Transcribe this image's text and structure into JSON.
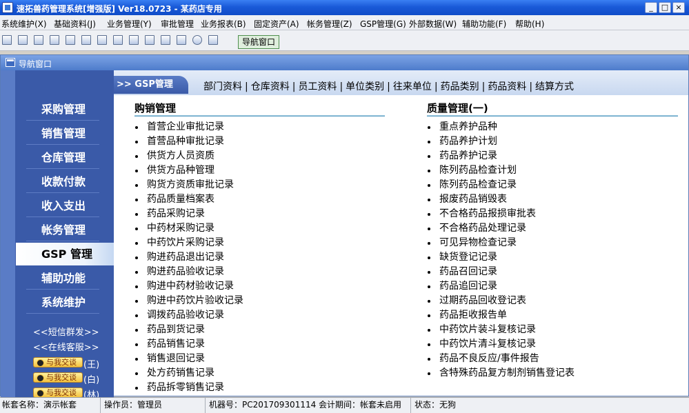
{
  "window": {
    "title": "速拓兽药管理系统[增强版] Ver18.0723 - 某药店专用",
    "min_glyph": "_",
    "max_glyph": "□",
    "close_glyph": "×"
  },
  "menu": [
    "系统维护(X)",
    "基础资料(J)",
    "业务管理(Y)",
    "审批管理",
    "业务报表(B)",
    "固定资产(A)",
    "帐务管理(Z)",
    "GSP管理(G)",
    "外部数据(W)",
    "辅助功能(F)",
    "帮助(H)"
  ],
  "toolbar": {
    "icons": [
      "grid-icon",
      "window-icon",
      "toolbox-icon",
      "card-icon",
      "chart-icon",
      "link-icon",
      "users-icon",
      "folder-icon",
      "edit-icon",
      "keyboard-icon",
      "save-icon",
      "print-icon",
      "help-icon",
      "exit-icon"
    ],
    "nav_button": "导航窗口"
  },
  "nav_window": {
    "title": "导航窗口"
  },
  "sidebar": {
    "items": [
      "采购管理",
      "销售管理",
      "仓库管理",
      "收款付款",
      "收入支出",
      "帐务管理",
      "GSP 管理",
      "辅助功能",
      "系统维护"
    ],
    "active_index": 6,
    "sms_link": "<<短信群发>>",
    "service_link": "<<在线客服>>",
    "qq": [
      {
        "label": "与我交谈",
        "who": "(王)"
      },
      {
        "label": "与我交谈",
        "who": "(白)"
      },
      {
        "label": "与我交谈",
        "who": "(林)"
      }
    ]
  },
  "content": {
    "section_tab": ">> GSP管理",
    "quick_links": [
      "部门资料",
      "仓库资料",
      "员工资料",
      "单位类别",
      "往来单位",
      "药品类别",
      "药品资料",
      "结算方式"
    ],
    "left_title": "购销管理",
    "left_items": [
      "首营企业审批记录",
      "首营品种审批记录",
      "供货方人员资质",
      "供货方品种管理",
      "购货方资质审批记录",
      "药品质量档案表",
      "药品采购记录",
      "中药材采购记录",
      "中药饮片采购记录",
      "购进药品退出记录",
      "购进药品验收记录",
      "购进中药材验收记录",
      "购进中药饮片验收记录",
      "调拨药品验收记录",
      "药品到货记录",
      "药品销售记录",
      "销售退回记录",
      "处方药销售记录",
      "药品拆零销售记录"
    ],
    "right_title": "质量管理(一)",
    "right_items": [
      "重点养护品种",
      "药品养护计划",
      "药品养护记录",
      "陈列药品检查计划",
      "陈列药品检查记录",
      "报废药品销毁表",
      "不合格药品报损审批表",
      "不合格药品处理记录",
      "可见异物检查记录",
      "缺货登记记录",
      "药品召回记录",
      "药品追回记录",
      "过期药品回收登记表",
      "药品拒收报告单",
      "中药饮片装斗复核记录",
      "中药饮片清斗复核记录",
      "药品不良反应/事件报告",
      "含特殊药品复方制剂销售登记表"
    ]
  },
  "status": {
    "account": "帐套名称：演示帐套",
    "operator": "操作员：管理员",
    "machine": "机器号：PC201709301114 会计期间：帐套未启用",
    "state": "状态：无狗"
  }
}
